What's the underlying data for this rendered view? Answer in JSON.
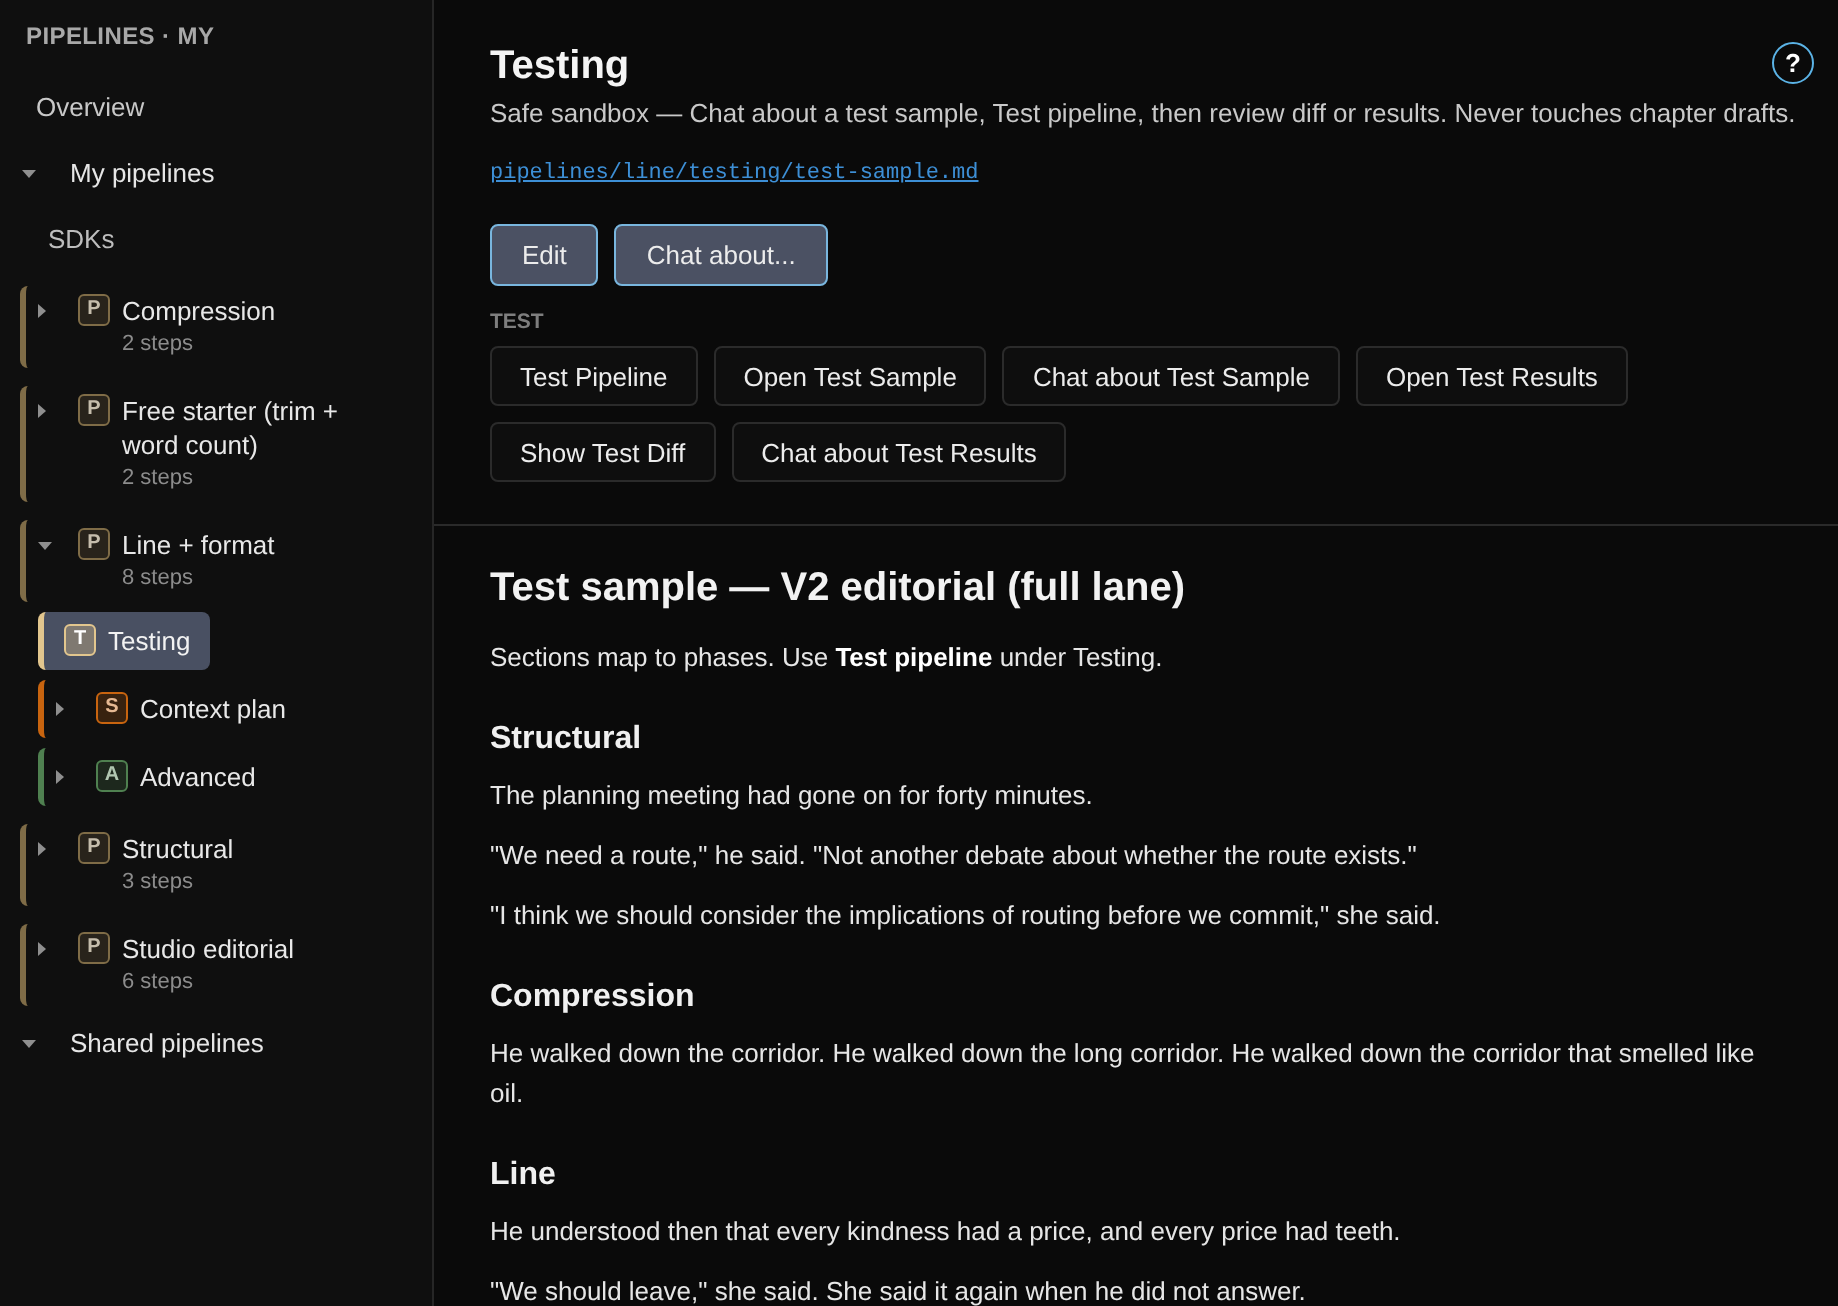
{
  "sidebar": {
    "title": "PIPELINES · MY",
    "items": [
      {
        "kind": "link",
        "label": "Overview",
        "selected": false
      },
      {
        "kind": "group",
        "label": "My pipelines",
        "expanded": true,
        "selected": false,
        "children": [
          {
            "kind": "link",
            "label": "SDKs",
            "selected": false
          },
          {
            "kind": "pipeline",
            "badge": "P",
            "color": "#7f6c47",
            "label": "Compression",
            "steps": "2 steps",
            "expanded": false,
            "selected": false
          },
          {
            "kind": "pipeline",
            "badge": "P",
            "color": "#7f6c47",
            "label": "Free starter (trim + word count)",
            "steps": "2 steps",
            "expanded": false,
            "selected": false
          },
          {
            "kind": "pipeline",
            "badge": "P",
            "color": "#7f6c47",
            "label": "Line + format",
            "steps": "8 steps",
            "expanded": true,
            "selected": false,
            "children": [
              {
                "kind": "pipeline",
                "badge": "T",
                "color": "#e2c68e",
                "label": "Testing",
                "selected": true
              },
              {
                "kind": "pipeline",
                "badge": "S",
                "color": "#c8640f",
                "label": "Context plan",
                "expanded": false,
                "selected": false
              },
              {
                "kind": "pipeline",
                "badge": "A",
                "color": "#4f8050",
                "label": "Advanced",
                "expanded": false,
                "selected": false
              }
            ]
          },
          {
            "kind": "pipeline",
            "badge": "P",
            "color": "#7f6c47",
            "label": "Structural",
            "steps": "3 steps",
            "expanded": false,
            "selected": false
          },
          {
            "kind": "pipeline",
            "badge": "P",
            "color": "#7f6c47",
            "label": "Studio editorial",
            "steps": "6 steps",
            "expanded": false,
            "selected": false
          }
        ]
      },
      {
        "kind": "group",
        "label": "Shared pipelines",
        "expanded": true,
        "selected": false
      }
    ]
  },
  "header": {
    "title": "Testing",
    "description": "Safe sandbox — Chat about a test sample, Test pipeline, then review diff or results. Never touches chapter drafts.",
    "path_link": "pipelines/line/testing/test-sample.md",
    "help_button": "?",
    "actions": [
      "Edit",
      "Chat about..."
    ]
  },
  "test_panel": {
    "heading": "TEST",
    "buttons": [
      "Test Pipeline",
      "Open Test Sample",
      "Chat about Test Sample",
      "Open Test Results",
      "Show Test Diff",
      "Chat about Test Results"
    ]
  },
  "document": {
    "title": "Test sample — V2 editorial (full lane)",
    "blocks": [
      {
        "kind": "paragraph",
        "text": "Sections map to phases. Use **Test pipeline** under Testing."
      },
      {
        "kind": "heading",
        "text": "Structural"
      },
      {
        "kind": "paragraph",
        "text": "The planning meeting had gone on for forty minutes."
      },
      {
        "kind": "paragraph",
        "text": "\"We need a route,\" he said. \"Not another debate about whether the route exists.\""
      },
      {
        "kind": "paragraph",
        "text": "\"I think we should consider the implications of routing before we commit,\" she said."
      },
      {
        "kind": "heading",
        "text": "Compression"
      },
      {
        "kind": "paragraph",
        "text": "He walked down the corridor. He walked down the long corridor. He walked down the corridor that smelled like oil."
      },
      {
        "kind": "heading",
        "text": "Line"
      },
      {
        "kind": "paragraph",
        "text": "He understood then that every kindness had a price, and every price had teeth."
      },
      {
        "kind": "paragraph",
        "text": "\"We should leave,\" she said. She said it again when he did not answer."
      }
    ]
  }
}
